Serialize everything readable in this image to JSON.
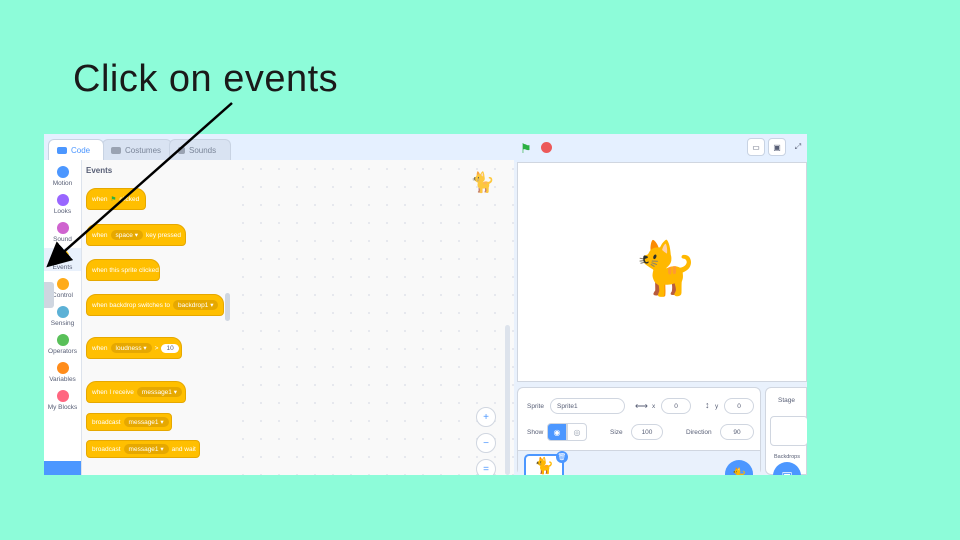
{
  "slide": {
    "title": "Click on events"
  },
  "tabs": [
    {
      "label": "Code"
    },
    {
      "label": "Costumes"
    },
    {
      "label": "Sounds"
    }
  ],
  "categories": [
    {
      "label": "Motion",
      "color": "#4c97ff"
    },
    {
      "label": "Looks",
      "color": "#9966ff"
    },
    {
      "label": "Sound",
      "color": "#cf63cf"
    },
    {
      "label": "Events",
      "color": "#ffbf00"
    },
    {
      "label": "Control",
      "color": "#ffab19"
    },
    {
      "label": "Sensing",
      "color": "#5cb1d6"
    },
    {
      "label": "Operators",
      "color": "#59c059"
    },
    {
      "label": "Variables",
      "color": "#ff8c1a"
    },
    {
      "label": "My Blocks",
      "color": "#ff6680"
    }
  ],
  "palette": {
    "title": "Events",
    "blocks": {
      "flag_when": "when",
      "flag_clicked": "clicked",
      "key_when": "when",
      "key_slot": "space",
      "key_rest": "key pressed",
      "sprite_clicked": "when this sprite clicked",
      "backdrop_when": "when backdrop switches to",
      "backdrop_slot": "backdrop1",
      "loud_when": "when",
      "loud_slot": "loudness",
      "loud_op": ">",
      "loud_num": "10",
      "receive_when": "when I receive",
      "receive_slot": "message1",
      "broadcast": "broadcast",
      "broadcast_slot": "message1",
      "broadcast_wait": "broadcast",
      "broadcast_wait_slot": "message1",
      "broadcast_wait_rest": "and wait"
    }
  },
  "sprite_info": {
    "sprite_label": "Sprite",
    "sprite_name": "Sprite1",
    "x_label": "x",
    "x_value": "0",
    "y_label": "y",
    "y_value": "0",
    "show_label": "Show",
    "size_label": "Size",
    "size_value": "100",
    "direction_label": "Direction",
    "direction_value": "90"
  },
  "stage_pane": {
    "title": "Stage",
    "backdrops_label": "Backdrops"
  },
  "colors": {
    "accent": "#4c97ff",
    "events": "#ffbf00",
    "background": "#8dfcd9"
  }
}
